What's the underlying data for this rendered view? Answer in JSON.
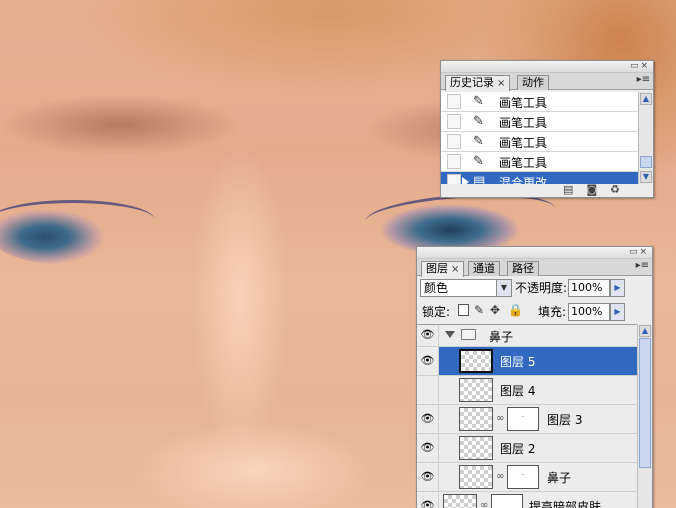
{
  "history_panel": {
    "tabs": [
      {
        "label": "历史记录",
        "close": "×"
      },
      {
        "label": "动作"
      }
    ],
    "menu_icon": "panel-menu-icon",
    "items": [
      {
        "label": "画笔工具",
        "icon": "brush-icon"
      },
      {
        "label": "画笔工具",
        "icon": "brush-icon"
      },
      {
        "label": "画笔工具",
        "icon": "brush-icon"
      },
      {
        "label": "画笔工具",
        "icon": "brush-icon"
      },
      {
        "label": "混合更改",
        "icon": "layer-blend-icon",
        "selected": true
      }
    ],
    "footer_icons": [
      "new-document-icon",
      "snapshot-camera-icon",
      "trash-icon"
    ]
  },
  "layers_panel": {
    "tabs": [
      {
        "label": "图层",
        "close": "×"
      },
      {
        "label": "通道"
      },
      {
        "label": "路径"
      }
    ],
    "blend_mode": "颜色",
    "opacity_label": "不透明度:",
    "opacity_value": "100%",
    "lock_label": "锁定:",
    "fill_label": "填充:",
    "fill_value": "100%",
    "layers": [
      {
        "name": "鼻子",
        "type": "group"
      },
      {
        "name": "图层 5",
        "selected": true
      },
      {
        "name": "图层 4"
      },
      {
        "name": "图层 3",
        "mask": true
      },
      {
        "name": "图层 2"
      },
      {
        "name": "鼻子",
        "mask": true
      },
      {
        "name": "提亮暗部皮肤",
        "mask": true,
        "partial": true
      }
    ]
  },
  "colors": {
    "selection": "#3269c0",
    "panel_bg": "#ececec"
  }
}
